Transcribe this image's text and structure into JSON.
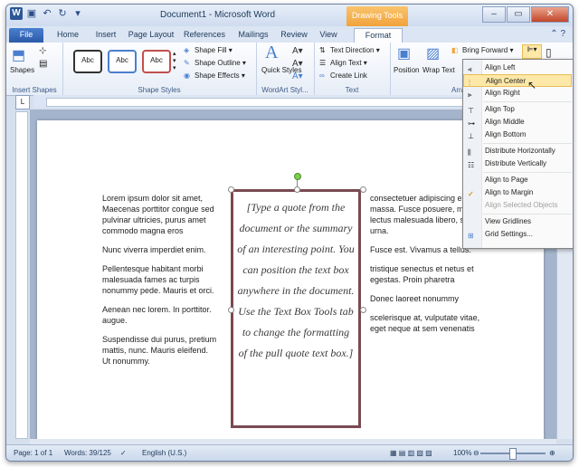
{
  "titlebar": {
    "title": "Document1 - Microsoft Word",
    "context_tab": "Drawing Tools"
  },
  "tabs": [
    "File",
    "Home",
    "Insert",
    "Page Layout",
    "References",
    "Mailings",
    "Review",
    "View",
    "Format"
  ],
  "ribbon": {
    "groups": [
      "Insert Shapes",
      "Shape Styles",
      "WordArt Styl...",
      "Text",
      "Arra..."
    ],
    "shapes_label": "Shapes",
    "style_swatch": "Abc",
    "shape_fill": "Shape Fill",
    "shape_outline": "Shape Outline",
    "shape_effects": "Shape Effects",
    "quick_styles": "Quick Styles",
    "text_direction": "Text Direction",
    "align_text": "Align Text",
    "create_link": "Create Link",
    "position": "Position",
    "wrap_text": "Wrap Text",
    "bring_forward": "Bring Forward"
  },
  "document": {
    "left_col": [
      "Lorem ipsum dolor sit amet, Maecenas porttitor congue sed pulvinar ultricies, purus amet commodo magna eros",
      "Nunc viverra imperdiet enim.",
      "Pellentesque habitant morbi malesuada fames ac turpis nonummy pede. Mauris et orci.",
      "Aenean nec lorem. In porttitor. augue.",
      "Suspendisse dui purus, pretium mattis, nunc. Mauris eleifend. Ut nonummy."
    ],
    "right_col": [
      "consectetuer adipiscing e massa. Fusce posuere, m lectus malesuada libero, s quis urna.",
      "Fusce est. Vivamus a tellus.",
      "tristique senectus et netus et egestas. Proin pharetra",
      "Donec laoreet nonummy",
      "scelerisque at, vulputate vitae, eget neque at sem venenatis"
    ],
    "quote": "[Type a quote from the document or the summary of an interesting point. You can position the text box anywhere in the document. Use the Text Box Tools tab to change the formatting of the pull quote text box.]"
  },
  "align_menu": {
    "items": [
      {
        "label": "Align Left",
        "icon": "align-left-icon"
      },
      {
        "label": "Align Center",
        "icon": "align-center-icon",
        "highlighted": true
      },
      {
        "label": "Align Right",
        "icon": "align-right-icon"
      },
      {
        "label": "Align Top",
        "icon": "align-top-icon"
      },
      {
        "label": "Align Middle",
        "icon": "align-middle-icon"
      },
      {
        "label": "Align Bottom",
        "icon": "align-bottom-icon"
      },
      {
        "label": "Distribute Horizontally",
        "icon": "distribute-horizontal-icon"
      },
      {
        "label": "Distribute Vertically",
        "icon": "distribute-vertical-icon"
      },
      {
        "label": "Align to Page",
        "icon": ""
      },
      {
        "label": "Align to Margin",
        "icon": "checkmark-icon",
        "checked": true
      },
      {
        "label": "Align Selected Objects",
        "icon": "",
        "disabled": true
      },
      {
        "label": "View Gridlines",
        "icon": ""
      },
      {
        "label": "Grid Settings...",
        "icon": "grid-icon"
      }
    ]
  },
  "status": {
    "page": "Page: 1 of 1",
    "words": "Words: 39/125",
    "language": "English (U.S.)",
    "zoom": "100%"
  },
  "colors": {
    "accent": "#2b5797",
    "context": "#f2a33b",
    "quote_border": "#7a4a52",
    "menu_highlight": "#fde8a8"
  }
}
